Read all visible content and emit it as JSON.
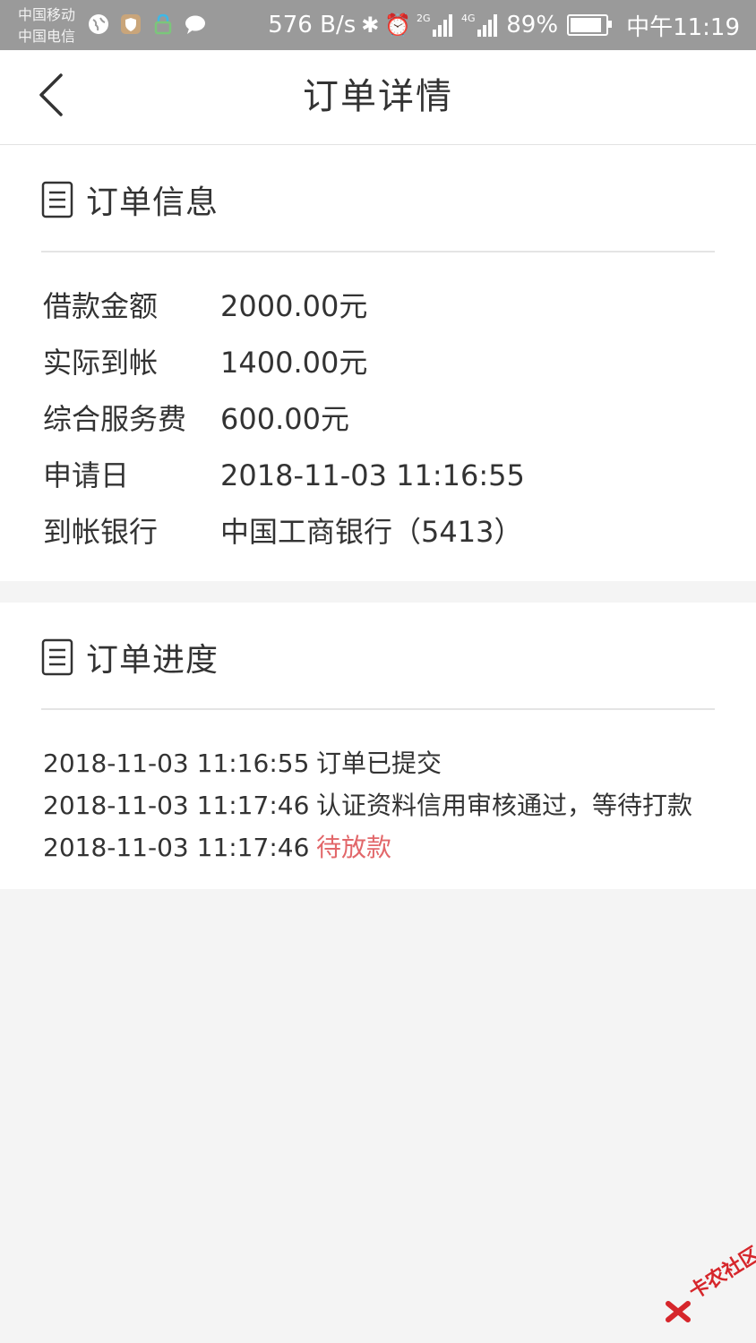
{
  "status_bar": {
    "carrier_1": "中国移动",
    "carrier_2": "中国电信",
    "net_speed": "576 B/s",
    "net_type_1": "2G",
    "net_type_2": "4G",
    "battery": "89%",
    "battery_level": 0.89,
    "time": "中午11:19"
  },
  "header": {
    "title": "订单详情"
  },
  "order_info": {
    "title": "订单信息",
    "rows": [
      {
        "label": "借款金额",
        "value": "2000.00元"
      },
      {
        "label": "实际到帐",
        "value": "1400.00元"
      },
      {
        "label": "综合服务费",
        "value": "600.00元"
      },
      {
        "label": "申请日",
        "value": "2018-11-03 11:16:55"
      },
      {
        "label": "到帐银行",
        "value": "中国工商银行（5413）"
      }
    ]
  },
  "order_progress": {
    "title": "订单进度",
    "rows": [
      {
        "time": "2018-11-03 11:16:55",
        "status": "订单已提交"
      },
      {
        "time": "2018-11-03 11:17:46",
        "status": "认证资料信用审核通过，等待打款"
      },
      {
        "time": "2018-11-03 11:17:46",
        "status": "待放款"
      }
    ]
  },
  "watermark": {
    "text": "卡农社区"
  },
  "colors": {
    "pending": "#e2676a",
    "status_bar_bg": "#9a9a9a",
    "watermark": "#d6262b"
  }
}
